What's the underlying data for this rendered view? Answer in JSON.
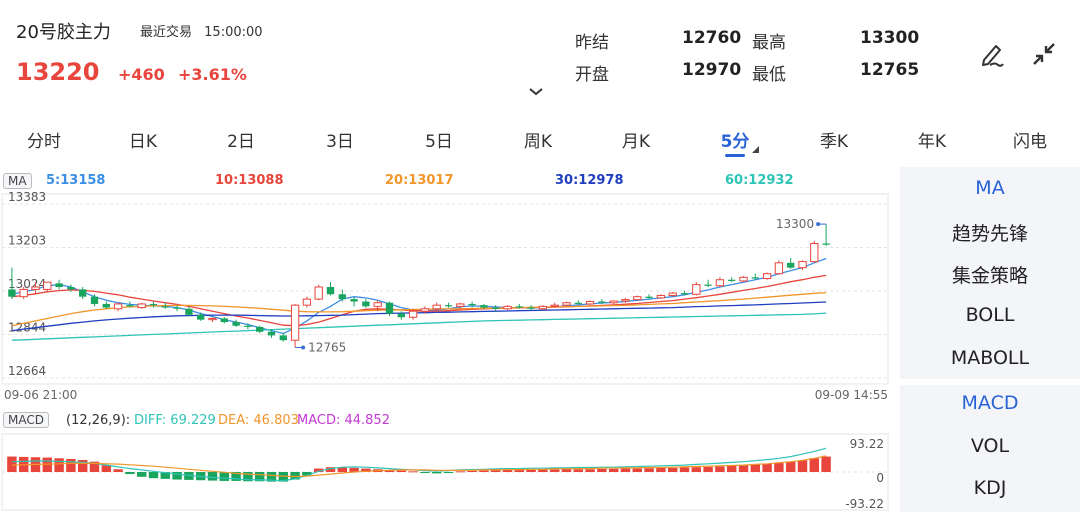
{
  "header": {
    "title": "20号胶主力",
    "last_trade_label": "最近交易",
    "last_trade_time": "15:00:00",
    "price": "13220",
    "change": "+460",
    "change_pct": "+3.61%",
    "stats": [
      {
        "label": "昨结",
        "value": "12760"
      },
      {
        "label": "最高",
        "value": "13300"
      },
      {
        "label": "开盘",
        "value": "12970"
      },
      {
        "label": "最低",
        "value": "12765"
      }
    ]
  },
  "tabs": [
    "分时",
    "日K",
    "2日",
    "3日",
    "5日",
    "周K",
    "月K",
    "5分",
    "季K",
    "年K",
    "闪电"
  ],
  "active_tab": "5分",
  "ma": {
    "tag": "MA",
    "items": [
      {
        "label": "5:13158",
        "color": "#3a8ee6"
      },
      {
        "label": "10:13088",
        "color": "#e8453c"
      },
      {
        "label": "20:13017",
        "color": "#f0962b"
      },
      {
        "label": "30:12978",
        "color": "#1f3fbf"
      },
      {
        "label": "60:12932",
        "color": "#2ec4b6"
      }
    ]
  },
  "price_axis": [
    "13383",
    "13203",
    "13024",
    "12844",
    "12664"
  ],
  "time_axis": {
    "start": "09-06 21:00",
    "end": "09-09 14:55"
  },
  "annotations": {
    "high": "13300",
    "low": "12765"
  },
  "macd": {
    "tag": "MACD",
    "params": "(12,26,9):",
    "diff": "DIFF: 69.229",
    "dea": "DEA: 46.803",
    "macd": "MACD: 44.852",
    "axis_top": "93.22",
    "axis_mid": "0",
    "axis_bottom": "-93.22"
  },
  "side_menu": {
    "group1": [
      "MA",
      "趋势先锋",
      "集金策略",
      "BOLL",
      "MABOLL"
    ],
    "group2": [
      "MACD",
      "VOL",
      "KDJ"
    ]
  },
  "colors": {
    "up": "#e8453c",
    "down": "#19a55e",
    "accent": "#2a63d6"
  },
  "chart_data": {
    "type": "candlestick",
    "interval": "5分",
    "ylim": [
      12664,
      13383
    ],
    "yticks": [
      13383,
      13203,
      13024,
      12844,
      12664
    ],
    "x_start": "09-06 21:00",
    "x_end": "09-09 14:55",
    "candles": [
      [
        13030,
        13120,
        12990,
        13000
      ],
      [
        13000,
        13040,
        12990,
        13030
      ],
      [
        13030,
        13060,
        13010,
        13040
      ],
      [
        13030,
        13060,
        13020,
        13060
      ],
      [
        13055,
        13070,
        13030,
        13040
      ],
      [
        13040,
        13050,
        13020,
        13030
      ],
      [
        13030,
        13040,
        12990,
        13000
      ],
      [
        13000,
        13010,
        12960,
        12970
      ],
      [
        12970,
        12980,
        12950,
        12955
      ],
      [
        12950,
        12975,
        12940,
        12970
      ],
      [
        12965,
        12980,
        12955,
        12960
      ],
      [
        12955,
        12975,
        12950,
        12970
      ],
      [
        12970,
        12980,
        12955,
        12965
      ],
      [
        12960,
        12975,
        12950,
        12955
      ],
      [
        12955,
        12965,
        12940,
        12950
      ],
      [
        12950,
        12960,
        12920,
        12925
      ],
      [
        12925,
        12935,
        12900,
        12905
      ],
      [
        12905,
        12915,
        12895,
        12910
      ],
      [
        12910,
        12915,
        12890,
        12895
      ],
      [
        12895,
        12905,
        12875,
        12880
      ],
      [
        12880,
        12890,
        12865,
        12875
      ],
      [
        12875,
        12880,
        12850,
        12855
      ],
      [
        12855,
        12865,
        12830,
        12840
      ],
      [
        12840,
        12850,
        12815,
        12820
      ],
      [
        12820,
        12970,
        12790,
        12965
      ],
      [
        12965,
        13000,
        12955,
        12990
      ],
      [
        12990,
        13050,
        12985,
        13040
      ],
      [
        13040,
        13060,
        13005,
        13010
      ],
      [
        13010,
        13030,
        12980,
        12990
      ],
      [
        12990,
        13000,
        12960,
        12980
      ],
      [
        12980,
        12990,
        12955,
        12960
      ],
      [
        12960,
        12985,
        12940,
        12975
      ],
      [
        12975,
        12980,
        12920,
        12930
      ],
      [
        12930,
        12940,
        12905,
        12915
      ],
      [
        12915,
        12950,
        12905,
        12940
      ],
      [
        12940,
        12960,
        12930,
        12950
      ],
      [
        12950,
        12975,
        12935,
        12965
      ],
      [
        12965,
        12975,
        12955,
        12960
      ],
      [
        12960,
        12975,
        12950,
        12970
      ],
      [
        12970,
        12980,
        12955,
        12965
      ],
      [
        12965,
        12970,
        12950,
        12955
      ],
      [
        12955,
        12965,
        12940,
        12950
      ],
      [
        12950,
        12965,
        12945,
        12960
      ],
      [
        12960,
        12970,
        12950,
        12955
      ],
      [
        12955,
        12965,
        12945,
        12950
      ],
      [
        12950,
        12965,
        12945,
        12960
      ],
      [
        12960,
        12975,
        12955,
        12965
      ],
      [
        12965,
        12980,
        12960,
        12975
      ],
      [
        12975,
        12985,
        12965,
        12970
      ],
      [
        12970,
        12985,
        12965,
        12980
      ],
      [
        12980,
        12990,
        12970,
        12975
      ],
      [
        12975,
        12985,
        12970,
        12982
      ],
      [
        12982,
        12995,
        12975,
        12988
      ],
      [
        12988,
        13005,
        12985,
        13000
      ],
      [
        13000,
        13010,
        12990,
        12995
      ],
      [
        12995,
        13010,
        12990,
        13005
      ],
      [
        13005,
        13020,
        13000,
        13015
      ],
      [
        13015,
        13025,
        13005,
        13010
      ],
      [
        13010,
        13060,
        13005,
        13050
      ],
      [
        13050,
        13070,
        13040,
        13045
      ],
      [
        13045,
        13080,
        13040,
        13070
      ],
      [
        13070,
        13080,
        13060,
        13065
      ],
      [
        13065,
        13085,
        13060,
        13080
      ],
      [
        13080,
        13095,
        13070,
        13075
      ],
      [
        13075,
        13100,
        13070,
        13095
      ],
      [
        13095,
        13150,
        13090,
        13140
      ],
      [
        13140,
        13160,
        13115,
        13120
      ],
      [
        13120,
        13150,
        13110,
        13145
      ],
      [
        13145,
        13230,
        13140,
        13220
      ],
      [
        13220,
        13300,
        13210,
        13215
      ]
    ],
    "ma_series": [
      {
        "name": "5",
        "color": "#3a8ee6",
        "values": [
          13010,
          13020,
          13030,
          13045,
          13050,
          13040,
          13020,
          13000,
          12985,
          12975,
          12968,
          12965,
          12962,
          12960,
          12955,
          12945,
          12930,
          12918,
          12905,
          12895,
          12885,
          12872,
          12860,
          12848,
          12870,
          12900,
          12935,
          12960,
          12990,
          13000,
          12995,
          12985,
          12970,
          12955,
          12945,
          12940,
          12945,
          12950,
          12958,
          12962,
          12960,
          12958,
          12955,
          12955,
          12954,
          12955,
          12958,
          12962,
          12966,
          12970,
          12974,
          12977,
          12980,
          12985,
          12990,
          12995,
          13000,
          13008,
          13018,
          13028,
          13040,
          13050,
          13060,
          13070,
          13080,
          13095,
          13108,
          13120,
          13140,
          13158
        ]
      },
      {
        "name": "10",
        "color": "#e8453c",
        "values": [
          13000,
          13005,
          13012,
          13020,
          13025,
          13028,
          13026,
          13022,
          13015,
          13008,
          12998,
          12990,
          12982,
          12975,
          12968,
          12960,
          12950,
          12940,
          12930,
          12920,
          12912,
          12902,
          12892,
          12882,
          12880,
          12885,
          12895,
          12910,
          12925,
          12940,
          12948,
          12950,
          12948,
          12945,
          12942,
          12940,
          12940,
          12942,
          12945,
          12948,
          12950,
          12952,
          12953,
          12954,
          12955,
          12956,
          12957,
          12958,
          12960,
          12962,
          12964,
          12966,
          12969,
          12972,
          12976,
          12980,
          12984,
          12990,
          12996,
          13003,
          13010,
          13018,
          13026,
          13034,
          13042,
          13052,
          13062,
          13070,
          13080,
          13088
        ]
      },
      {
        "name": "20",
        "color": "#f0962b",
        "values": [
          12880,
          12890,
          12900,
          12910,
          12920,
          12930,
          12938,
          12945,
          12950,
          12955,
          12958,
          12960,
          12962,
          12963,
          12964,
          12964,
          12963,
          12962,
          12960,
          12958,
          12955,
          12952,
          12948,
          12944,
          12940,
          12938,
          12937,
          12937,
          12938,
          12940,
          12942,
          12944,
          12945,
          12946,
          12947,
          12948,
          12949,
          12950,
          12950,
          12951,
          12952,
          12953,
          12954,
          12955,
          12956,
          12957,
          12958,
          12959,
          12960,
          12961,
          12962,
          12963,
          12964,
          12966,
          12968,
          12970,
          12972,
          12975,
          12978,
          12981,
          12984,
          12987,
          12990,
          12994,
          12998,
          13002,
          13006,
          13010,
          13014,
          13017
        ]
      },
      {
        "name": "30",
        "color": "#1f3fbf",
        "values": [
          12860,
          12866,
          12872,
          12878,
          12884,
          12890,
          12895,
          12900,
          12904,
          12908,
          12911,
          12914,
          12917,
          12919,
          12921,
          12922,
          12923,
          12924,
          12924,
          12924,
          12923,
          12922,
          12921,
          12920,
          12920,
          12921,
          12922,
          12923,
          12924,
          12926,
          12928,
          12930,
          12931,
          12932,
          12933,
          12934,
          12935,
          12936,
          12937,
          12938,
          12939,
          12940,
          12941,
          12942,
          12943,
          12944,
          12945,
          12946,
          12947,
          12948,
          12949,
          12950,
          12951,
          12952,
          12953,
          12954,
          12955,
          12957,
          12959,
          12960,
          12962,
          12963,
          12965,
          12966,
          12968,
          12970,
          12972,
          12974,
          12976,
          12978
        ]
      },
      {
        "name": "60",
        "color": "#2ec4b6",
        "values": [
          12820,
          12822,
          12824,
          12826,
          12828,
          12830,
          12832,
          12834,
          12836,
          12838,
          12840,
          12842,
          12844,
          12846,
          12848,
          12850,
          12852,
          12854,
          12856,
          12858,
          12860,
          12862,
          12864,
          12866,
          12868,
          12870,
          12872,
          12874,
          12876,
          12878,
          12880,
          12882,
          12884,
          12886,
          12888,
          12890,
          12892,
          12894,
          12896,
          12898,
          12900,
          12901,
          12902,
          12903,
          12904,
          12905,
          12906,
          12907,
          12908,
          12909,
          12910,
          12911,
          12912,
          12913,
          12914,
          12915,
          12916,
          12917,
          12918,
          12919,
          12920,
          12921,
          12922,
          12923,
          12924,
          12925,
          12926,
          12927,
          12929,
          12932
        ]
      }
    ],
    "macd_hist": [
      45,
      44,
      43,
      42,
      40,
      38,
      35,
      30,
      20,
      8,
      -6,
      -14,
      -18,
      -20,
      -22,
      -23,
      -24,
      -25,
      -26,
      -26,
      -27,
      -27,
      -28,
      -28,
      -22,
      -10,
      10,
      14,
      14,
      12,
      10,
      8,
      6,
      4,
      2,
      -2,
      -4,
      -2,
      2,
      3,
      4,
      5,
      6,
      6,
      6,
      7,
      7,
      8,
      8,
      8,
      9,
      9,
      10,
      10,
      11,
      12,
      12,
      13,
      14,
      15,
      16,
      18,
      20,
      22,
      24,
      26,
      30,
      34,
      40,
      44.852
    ],
    "diff_values": [
      30,
      31,
      32,
      32,
      31,
      30,
      28,
      25,
      20,
      15,
      10,
      6,
      2,
      -2,
      -6,
      -10,
      -13,
      -16,
      -18,
      -20,
      -22,
      -23,
      -24,
      -25,
      -20,
      -10,
      2,
      10,
      14,
      15,
      14,
      12,
      10,
      8,
      6,
      4,
      3,
      4,
      6,
      7,
      8,
      9,
      10,
      10,
      11,
      11,
      12,
      12,
      13,
      13,
      14,
      14,
      15,
      16,
      17,
      18,
      19,
      20,
      22,
      24,
      26,
      28,
      30,
      33,
      36,
      40,
      45,
      52,
      60,
      69.229
    ],
    "dea_values": [
      20,
      21,
      22,
      23,
      24,
      25,
      25,
      25,
      24,
      23,
      21,
      19,
      17,
      14,
      11,
      8,
      5,
      2,
      -1,
      -4,
      -6,
      -8,
      -10,
      -12,
      -13,
      -12,
      -9,
      -6,
      -3,
      0,
      2,
      4,
      5,
      6,
      6,
      6,
      5,
      5,
      5,
      5,
      6,
      6,
      7,
      7,
      8,
      8,
      9,
      9,
      10,
      10,
      11,
      11,
      12,
      12,
      13,
      13,
      14,
      15,
      16,
      17,
      18,
      19,
      20,
      22,
      24,
      27,
      30,
      34,
      40,
      46.803
    ],
    "macd_ylim": [
      -93.22,
      93.22
    ]
  }
}
